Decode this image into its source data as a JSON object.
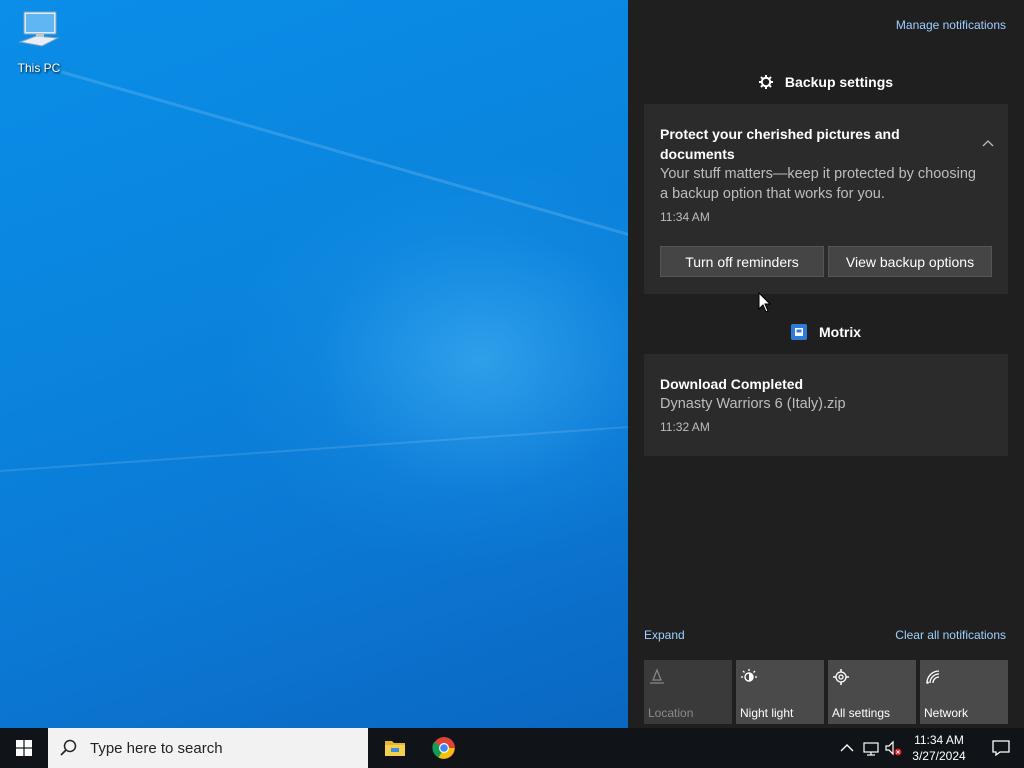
{
  "desktop": {
    "icons": [
      {
        "label": "This PC",
        "icon": "computer-icon"
      }
    ]
  },
  "action_center": {
    "manage_label": "Manage notifications",
    "groups": [
      {
        "app": "Backup settings",
        "icon": "gear-icon",
        "notification": {
          "title": "Protect your cherished pictures and documents",
          "body": "Your stuff matters—keep it protected by choosing a backup option that works for you.",
          "time": "11:34 AM",
          "buttons": [
            "Turn off reminders",
            "View backup options"
          ]
        }
      },
      {
        "app": "Motrix",
        "icon": "motrix-app-icon",
        "notification": {
          "title": "Download Completed",
          "body": "Dynasty Warriors 6 (Italy).zip",
          "time": "11:32 AM"
        }
      }
    ],
    "expand_label": "Expand",
    "clear_label": "Clear all notifications",
    "quick_actions": [
      {
        "label": "Location",
        "icon": "location-icon",
        "enabled": false
      },
      {
        "label": "Night light",
        "icon": "night-light-icon",
        "enabled": true
      },
      {
        "label": "All settings",
        "icon": "gear-icon",
        "enabled": true
      },
      {
        "label": "Network",
        "icon": "network-icon",
        "enabled": true
      }
    ]
  },
  "taskbar": {
    "search_placeholder": "Type here to search",
    "pinned_apps": [
      "file-explorer-icon",
      "chrome-icon"
    ],
    "clock": {
      "time": "11:34 AM",
      "date": "3/27/2024"
    }
  },
  "colors": {
    "accent_link": "#9fd0ff",
    "panel_bg": "#1f1f1f",
    "card_bg": "#2b2b2b",
    "taskbar_bg": "#101418"
  }
}
